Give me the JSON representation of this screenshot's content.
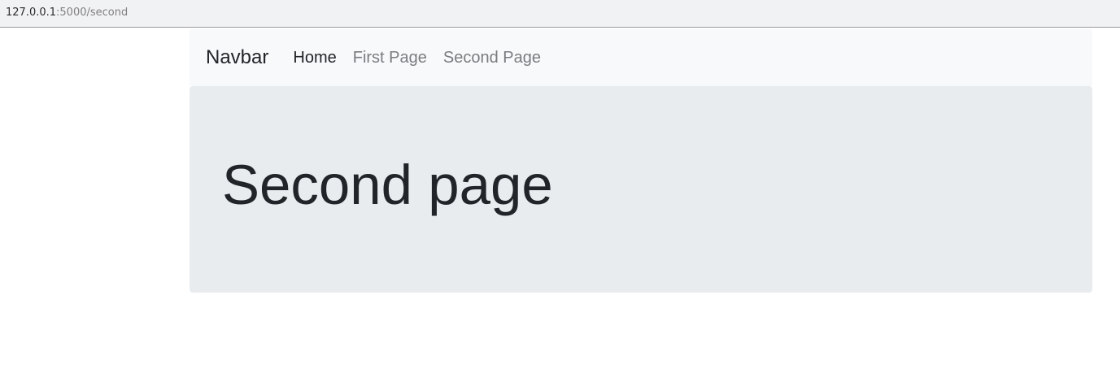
{
  "browser": {
    "url_host": "127.0.0.1",
    "url_rest": ":5000/second"
  },
  "navbar": {
    "brand": "Navbar",
    "links": [
      {
        "label": "Home"
      },
      {
        "label": "First Page"
      },
      {
        "label": "Second Page"
      }
    ]
  },
  "main": {
    "heading": "Second page"
  }
}
